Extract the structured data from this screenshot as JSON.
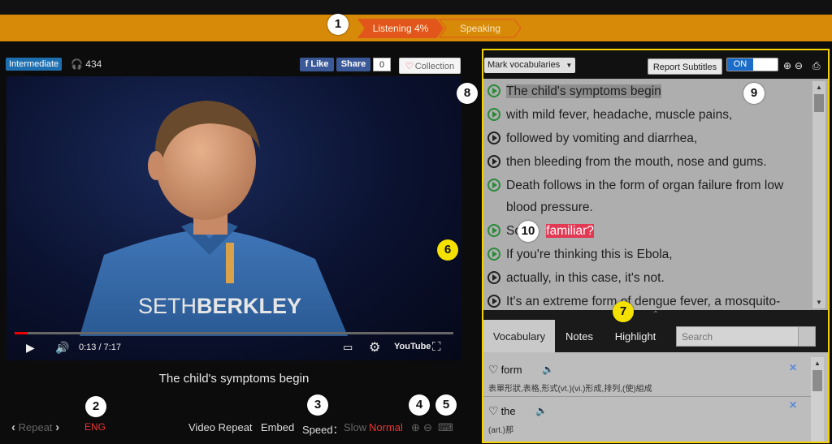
{
  "header": {
    "tabs": [
      {
        "label": "Listening 4%"
      },
      {
        "label": "Speaking"
      }
    ]
  },
  "badges": [
    "1",
    "2",
    "3",
    "4",
    "5",
    "6",
    "7",
    "8",
    "9",
    "10"
  ],
  "meta": {
    "level": "Intermediate",
    "views": "434",
    "like_label": "Like",
    "share_label": "Share",
    "share_count": "0",
    "collection_label": "Collection"
  },
  "video": {
    "speaker_first": "SETH",
    "speaker_last": "BERKLEY",
    "time": "0:13 / 7:17",
    "progress": 0.03,
    "youtube_label": "YouTube"
  },
  "subtitle": "The child's symptoms begin",
  "controls": {
    "repeat_label": "Repeat",
    "language": "ENG",
    "video_repeat": "Video Repeat",
    "embed": "Embed",
    "speed_label": "Speed：",
    "speed_slow": "Slow",
    "speed_normal": "Normal"
  },
  "right_toolbar": {
    "mark_vocab": "Mark vocabularies",
    "report": "Report Subtitles",
    "toggle_on": "ON"
  },
  "transcript": {
    "lines": [
      {
        "text": "The child's symptoms begin"
      },
      {
        "text": "with mild fever, headache, muscle pains,"
      },
      {
        "text": "followed by vomiting and diarrhea,"
      },
      {
        "text": "then bleeding from the mouth, nose and gums."
      },
      {
        "text": "Death follows in the form of organ failure from low"
      },
      {
        "text": "blood pressure."
      },
      {
        "text_before": "So",
        "text_highlight": "familiar?"
      },
      {
        "text": "If you're thinking this is Ebola,"
      },
      {
        "text": "actually, in this case, it's not."
      },
      {
        "text": "It's an extreme form of dengue fever, a mosquito-"
      }
    ]
  },
  "vocab_tabs": {
    "vocabulary": "Vocabulary",
    "notes": "Notes",
    "highlight": "Highlight",
    "search_placeholder": "Search"
  },
  "vocab_list": [
    {
      "word": "form",
      "definition": "表單形狀,表格,形式(vt.)(vi.)形成,排列,(使)組成"
    },
    {
      "word": "the",
      "definition": "(art.)那"
    }
  ],
  "colors": {
    "topbar": "#d78a08",
    "active_tab": "#e2561b",
    "panel_border": "#f4d200",
    "badge_yellow": "#f5e100",
    "highlight_red": "#e23a55",
    "play_green": "#2a8a3a"
  }
}
